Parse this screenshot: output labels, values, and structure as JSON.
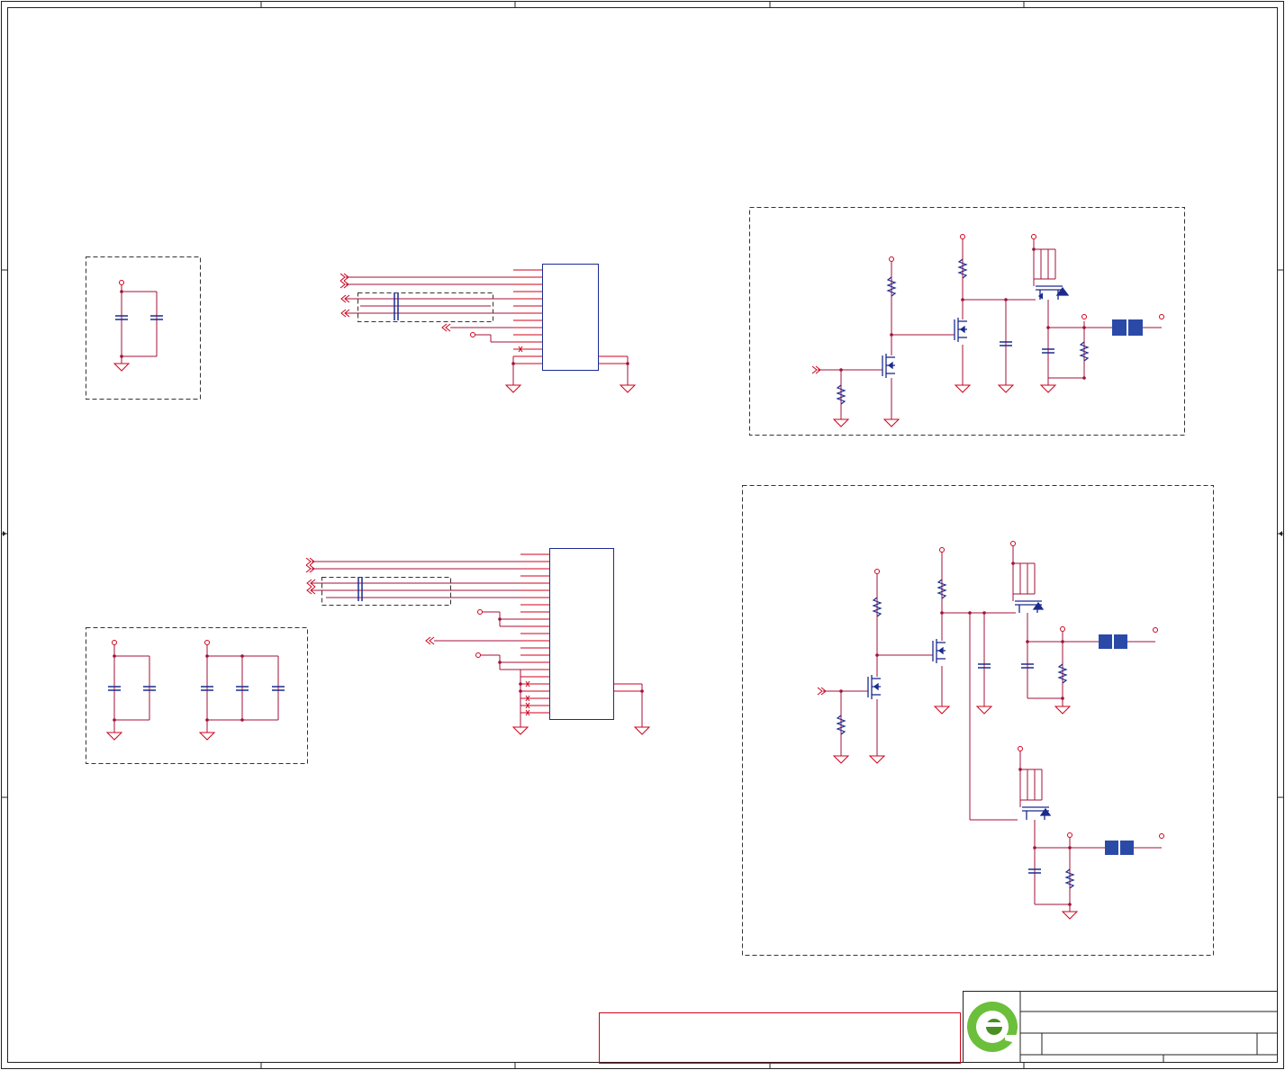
{
  "colors": {
    "net": "#a4103a",
    "pin": "#d0021b",
    "part": "#1b2a8f",
    "frame": "#222222",
    "dash": "#333333",
    "fuse": "#2b4aa8",
    "logo_green": "#6cbf3a",
    "logo_dark": "#4a8f23",
    "note_box": "#d0021b"
  }
}
